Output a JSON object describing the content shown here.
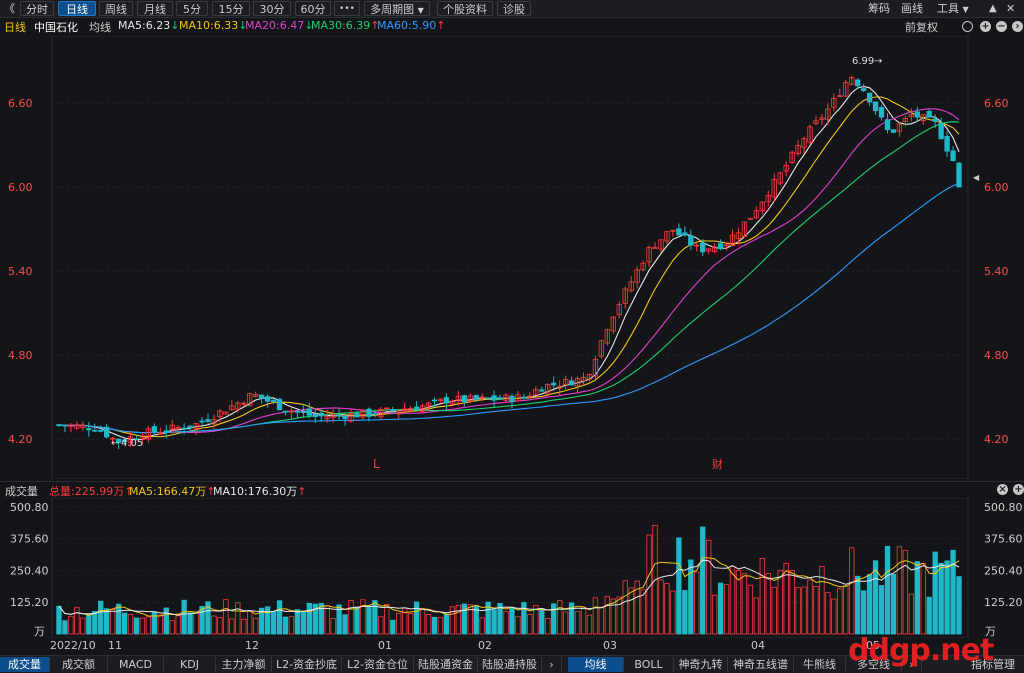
{
  "toolbar": {
    "back": "《",
    "periods": [
      "分时",
      "日线",
      "周线",
      "月线",
      "5分",
      "15分",
      "30分",
      "60分"
    ],
    "active_period": "日线",
    "more": "•••",
    "multi_period": "多周期图",
    "stock_info": "个股资料",
    "diagnose": "诊股",
    "chips": "筹码",
    "draw": "画线",
    "tools": "工具"
  },
  "legend": {
    "period": "日线",
    "stock": "中国石化",
    "ma_label": "均线",
    "ma": [
      {
        "label": "MA5:6.23",
        "arrow": "↓",
        "color": "#e8e8e8",
        "arrow_color": "#19c37d"
      },
      {
        "label": "MA10:6.33",
        "arrow": "↓",
        "color": "#f5c518",
        "arrow_color": "#19c37d"
      },
      {
        "label": "MA20:6.47",
        "arrow": "↓",
        "color": "#e040d0",
        "arrow_color": "#19c37d"
      },
      {
        "label": "MA30:6.39",
        "arrow": "↑",
        "color": "#1fcf6f",
        "arrow_color": "#ff3b3b"
      },
      {
        "label": "MA60:5.90",
        "arrow": "↑",
        "color": "#2e9bff",
        "arrow_color": "#ff3b3b"
      }
    ],
    "adjust": "前复权"
  },
  "price_axis": {
    "ticks": [
      "6.60",
      "6.00",
      "5.40",
      "4.80",
      "4.20"
    ],
    "values": [
      6.6,
      6.0,
      5.4,
      4.8,
      4.2
    ],
    "ylim": [
      3.95,
      7.05
    ]
  },
  "annotations": {
    "high": "6.99",
    "low": "4.05",
    "marker_l": "L",
    "marker_cai": "财"
  },
  "volume_legend": {
    "title": "成交量",
    "total": "总量:225.99万",
    "total_arrow": "↑",
    "ma5": "MA5:166.47万",
    "ma5_arrow": "↑",
    "ma10": "MA10:176.30万",
    "ma10_arrow": "↑"
  },
  "volume_axis": {
    "ticks": [
      "500.80",
      "375.60",
      "250.40",
      "125.20"
    ],
    "values": [
      500.8,
      375.6,
      250.4,
      125.2
    ],
    "unit": "万",
    "ylim": [
      0,
      520
    ]
  },
  "date_axis": [
    "2022/10",
    "11",
    "12",
    "01",
    "02",
    "03",
    "04",
    "05"
  ],
  "tabs": [
    "成交量",
    "成交额",
    "MACD",
    "KDJ",
    "主力净额",
    "L2-资金抄底",
    "L2-资金仓位",
    "陆股通资金",
    "陆股通持股"
  ],
  "tabs_right": [
    "均线",
    "BOLL",
    "神奇九转",
    "神奇五线谱",
    "牛熊线",
    "多空线"
  ],
  "tabs_far_right": "指标管理",
  "watermark": "ddgp.net",
  "colors": {
    "up": "#ff3b3b",
    "down": "#1fb8c8",
    "bg": "#141518",
    "grid": "#262830"
  },
  "chart_data": {
    "type": "candlestick",
    "x": "trading days Oct 2022 – May 2023",
    "ohlc_summary": {
      "low": 4.05,
      "high": 6.99,
      "last_close": 6.0
    },
    "ma_last": {
      "MA5": 6.23,
      "MA10": 6.33,
      "MA20": 6.47,
      "MA30": 6.39,
      "MA60": 5.9
    },
    "volume_last": 225.99,
    "volume_unit": "万"
  }
}
